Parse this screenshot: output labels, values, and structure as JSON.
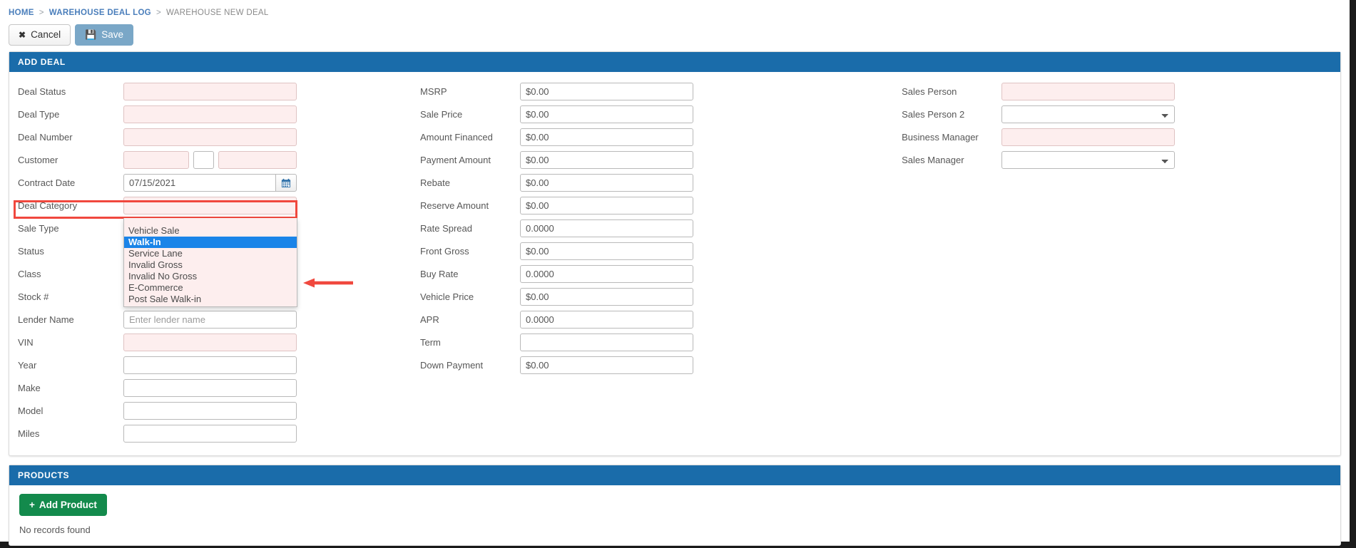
{
  "breadcrumb": {
    "home": "HOME",
    "sep": ">",
    "deal_log": "WAREHOUSE DEAL LOG",
    "current": "WAREHOUSE NEW DEAL"
  },
  "toolbar": {
    "cancel_label": "Cancel",
    "save_label": "Save"
  },
  "add_deal_panel": {
    "title": "ADD DEAL"
  },
  "left_column": {
    "fields": [
      {
        "label": "Deal Status",
        "type": "select",
        "value": "",
        "required": true
      },
      {
        "label": "Deal Type",
        "type": "select",
        "value": "",
        "required": true
      },
      {
        "label": "Deal Number",
        "type": "text",
        "value": "",
        "required": true
      },
      {
        "label": "Customer",
        "type": "triple",
        "value": "",
        "required": true
      },
      {
        "label": "Contract Date",
        "type": "date",
        "value": "07/15/2021",
        "required": false
      },
      {
        "label": "Deal Category",
        "type": "select",
        "value": "",
        "required": true
      },
      {
        "label": "Sale Type",
        "type": "select",
        "value": "",
        "required": true
      },
      {
        "label": "Status",
        "type": "select",
        "value": "",
        "required": true
      },
      {
        "label": "Class",
        "type": "select",
        "value": "",
        "required": true
      },
      {
        "label": "Stock #",
        "type": "text",
        "value": "",
        "required": true
      },
      {
        "label": "Lender Name",
        "type": "text",
        "value": "",
        "placeholder": "Enter lender name",
        "required": false
      },
      {
        "label": "VIN",
        "type": "text",
        "value": "",
        "required": true
      },
      {
        "label": "Year",
        "type": "text",
        "value": "",
        "required": false
      },
      {
        "label": "Make",
        "type": "text",
        "value": "",
        "required": false
      },
      {
        "label": "Model",
        "type": "text",
        "value": "",
        "required": false
      },
      {
        "label": "Miles",
        "type": "text",
        "value": "",
        "required": false
      }
    ]
  },
  "deal_category_dropdown": {
    "open": true,
    "selected": "Walk-In",
    "options": [
      "Vehicle Sale",
      "Walk-In",
      "Service Lane",
      "Invalid Gross",
      "Invalid No Gross",
      "E-Commerce",
      "Post Sale Walk-in"
    ]
  },
  "annotation": {
    "highlight_color": "#f0483e",
    "arrow_color": "#f0483e"
  },
  "middle_column": {
    "fields": [
      {
        "label": "MSRP",
        "value": "$0.00"
      },
      {
        "label": "Sale Price",
        "value": "$0.00"
      },
      {
        "label": "Amount Financed",
        "value": "$0.00"
      },
      {
        "label": "Payment Amount",
        "value": "$0.00"
      },
      {
        "label": "Rebate",
        "value": "$0.00"
      },
      {
        "label": "Reserve Amount",
        "value": "$0.00"
      },
      {
        "label": "Rate Spread",
        "value": "0.0000"
      },
      {
        "label": "Front Gross",
        "value": "$0.00"
      },
      {
        "label": "Buy Rate",
        "value": "0.0000"
      },
      {
        "label": "Vehicle Price",
        "value": "$0.00"
      },
      {
        "label": "APR",
        "value": "0.0000"
      },
      {
        "label": "Term",
        "value": ""
      },
      {
        "label": "Down Payment",
        "value": "$0.00"
      }
    ]
  },
  "right_column": {
    "fields": [
      {
        "label": "Sales Person",
        "value": "",
        "required": true
      },
      {
        "label": "Sales Person 2",
        "value": "",
        "required": false
      },
      {
        "label": "Business Manager",
        "value": "",
        "required": true
      },
      {
        "label": "Sales Manager",
        "value": "",
        "required": false
      }
    ]
  },
  "products_panel": {
    "title": "PRODUCTS",
    "add_label": "Add Product",
    "plus": "+",
    "empty_text": "No records found"
  }
}
